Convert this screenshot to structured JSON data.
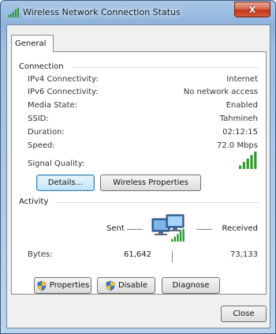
{
  "window": {
    "title": "Wireless Network Connection Status",
    "close_label": "X"
  },
  "tabs": [
    {
      "label": "General"
    }
  ],
  "connection": {
    "group_title": "Connection",
    "rows": [
      {
        "label": "IPv4 Connectivity:",
        "value": "Internet"
      },
      {
        "label": "IPv6 Connectivity:",
        "value": "No network access"
      },
      {
        "label": "Media State:",
        "value": "Enabled"
      },
      {
        "label": "SSID:",
        "value": "Tahmineh"
      },
      {
        "label": "Duration:",
        "value": "02:12:15"
      },
      {
        "label": "Speed:",
        "value": "72.0 Mbps"
      }
    ],
    "signal_label": "Signal Quality:",
    "signal_bars": 5,
    "signal_bars_max": 5,
    "details_button": "Details...",
    "wireless_props_button": "Wireless Properties"
  },
  "activity": {
    "group_title": "Activity",
    "sent_label": "Sent",
    "received_label": "Received",
    "bytes_label": "Bytes:",
    "bytes_sent": "61,642",
    "bytes_received": "73,133"
  },
  "buttons": {
    "properties": "Properties",
    "disable": "Disable",
    "diagnose": "Diagnose",
    "close": "Close"
  },
  "colors": {
    "signal_green": "#2e9b2e",
    "focus_blue": "#3c7fb1"
  }
}
